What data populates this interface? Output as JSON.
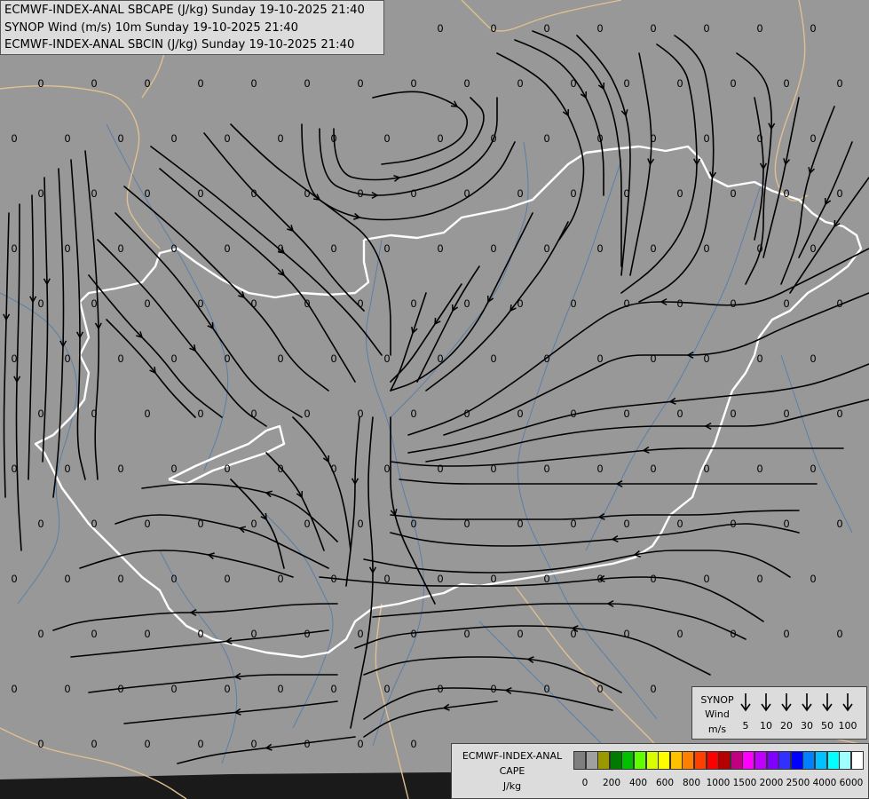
{
  "header": {
    "line1": "ECMWF-INDEX-ANAL SBCAPE (J/kg) Sunday 19-10-2025 21:40",
    "line2": "SYNOP Wind (m/s) 10m Sunday 19-10-2025 21:40",
    "line3": "ECMWF-INDEX-ANAL SBCIN (J/kg) Sunday 19-10-2025 21:40"
  },
  "map": {
    "background_color": "#989898",
    "border_color": "#ffffff",
    "neighbor_border_color": "#e0c090",
    "river_color": "#5a7fa8",
    "streamline_color": "#000000",
    "grid_value_label": "0"
  },
  "synop_legend": {
    "title_lines": [
      "SYNOP",
      "Wind",
      "m/s"
    ],
    "speeds": [
      "5",
      "10",
      "20",
      "30",
      "50",
      "100"
    ]
  },
  "cape_legend": {
    "title_lines": [
      "ECMWF-INDEX-ANAL",
      "CAPE",
      "J/kg"
    ],
    "colors": [
      "#7f7f7f",
      "#a0a0a0",
      "#9a9a00",
      "#007a00",
      "#00c000",
      "#60ff00",
      "#d8ff00",
      "#ffff00",
      "#ffc000",
      "#ff8000",
      "#ff4000",
      "#ff0000",
      "#b40000",
      "#c00080",
      "#ff00ff",
      "#c000ff",
      "#7f00ff",
      "#3030ff",
      "#0000ff",
      "#0080ff",
      "#00c0ff",
      "#00ffff",
      "#a0ffff",
      "#ffffff"
    ],
    "ticks": [
      "0",
      "200",
      "400",
      "600",
      "800",
      "1000",
      "1500",
      "2000",
      "2500",
      "4000",
      "6000"
    ]
  }
}
